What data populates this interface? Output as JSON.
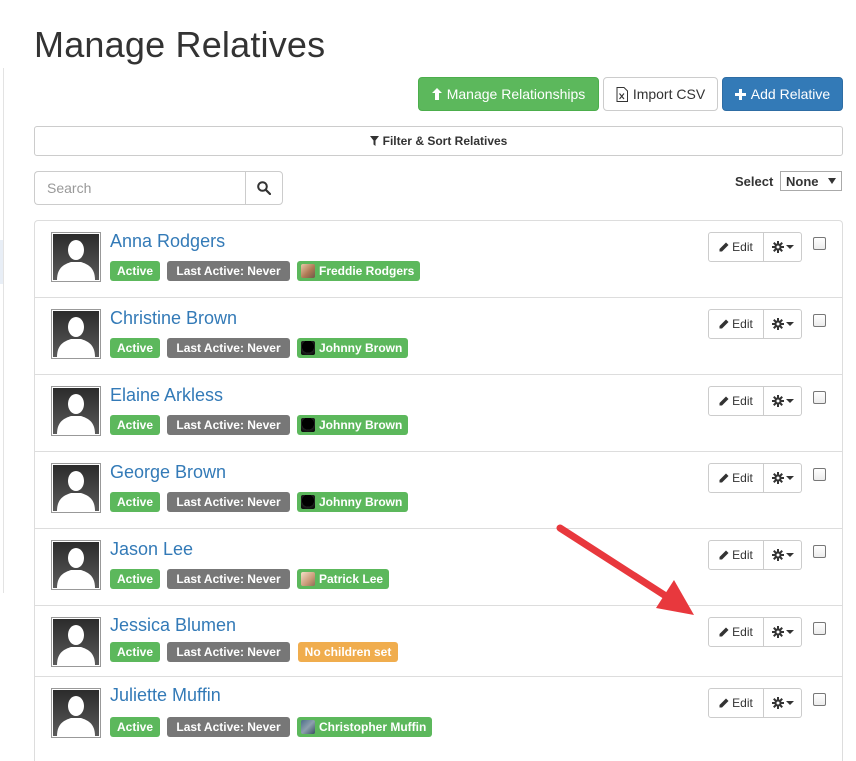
{
  "page": {
    "title": "Manage Relatives"
  },
  "actions": {
    "manage_relationships": "Manage Relationships",
    "import_csv": "Import CSV",
    "add_relative": "Add Relative"
  },
  "filter": {
    "label": "Filter & Sort Relatives"
  },
  "search": {
    "placeholder": "Search",
    "value": ""
  },
  "select": {
    "label": "Select",
    "value": "None"
  },
  "row_actions": {
    "edit_label": "Edit"
  },
  "relatives": [
    {
      "name": "Anna Rodgers",
      "status": "Active",
      "last_active": "Last Active: Never",
      "child": "Freddie Rodgers",
      "child_thumb": "light"
    },
    {
      "name": "Christine Brown",
      "status": "Active",
      "last_active": "Last Active: Never",
      "child": "Johnny Brown",
      "child_thumb": "dark"
    },
    {
      "name": "Elaine Arkless",
      "status": "Active",
      "last_active": "Last Active: Never",
      "child": "Johnny Brown",
      "child_thumb": "dark"
    },
    {
      "name": "George Brown",
      "status": "Active",
      "last_active": "Last Active: Never",
      "child": "Johnny Brown",
      "child_thumb": "dark"
    },
    {
      "name": "Jason Lee",
      "status": "Active",
      "last_active": "Last Active: Never",
      "child": "Patrick Lee",
      "child_thumb": "lee"
    },
    {
      "name": "Jessica Blumen",
      "status": "Active",
      "last_active": "Last Active: Never",
      "no_children": "No children set"
    },
    {
      "name": "Juliette Muffin",
      "status": "Active",
      "last_active": "Last Active: Never",
      "child": "Christopher Muffin",
      "child_thumb": "muffin"
    }
  ],
  "colors": {
    "success": "#5cb85c",
    "primary": "#337ab7",
    "warning": "#f0ad4e",
    "muted": "#777777",
    "annotation_arrow": "#e8383d"
  }
}
